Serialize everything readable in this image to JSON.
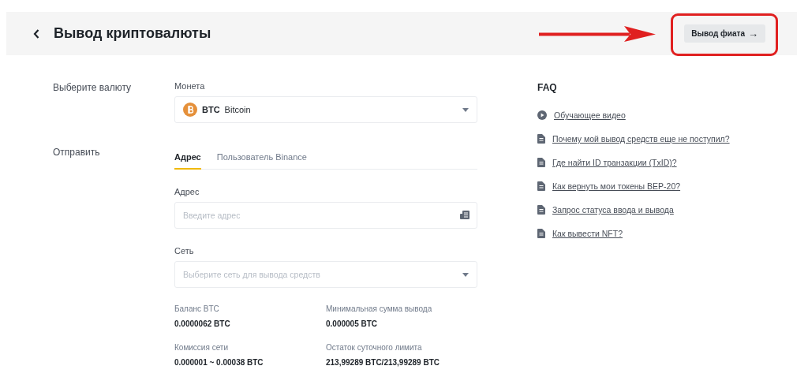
{
  "header": {
    "title": "Вывод криптовалюты",
    "button": {
      "label": "Вывод фиата",
      "icon": "→"
    }
  },
  "form": {
    "currency": {
      "section_label": "Выберите валюту",
      "field_label": "Монета",
      "coin_code": "BTC",
      "coin_name": "Bitcoin"
    },
    "send": {
      "section_label": "Отправить",
      "tabs": [
        {
          "label": "Адрес",
          "selected": true
        },
        {
          "label": "Пользователь Binance",
          "selected": false
        }
      ],
      "address": {
        "label": "Адрес",
        "placeholder": "Введите адрес"
      },
      "network": {
        "label": "Сеть",
        "placeholder": "Выберите сеть для вывода средств"
      },
      "info": [
        {
          "label": "Баланс BTC",
          "value": "0.0000062 BTC"
        },
        {
          "label": "Минимальная сумма вывода",
          "value": "0.000005 BTC"
        },
        {
          "label": "Комиссия сети",
          "value": "0.000001 ~ 0.00038 BTC"
        },
        {
          "label": "Остаток суточного лимита",
          "value": "213,99289 BTC/213,99289 BTC"
        }
      ]
    }
  },
  "faq": {
    "title": "FAQ",
    "items": [
      {
        "kind": "video",
        "text": "Обучающее видео"
      },
      {
        "kind": "article",
        "text": "Почему мой вывод средств еще не поступил?"
      },
      {
        "kind": "article",
        "text": "Где найти ID транзакции (TxID)?"
      },
      {
        "kind": "article",
        "text": "Как вернуть мои токены BEP-20?"
      },
      {
        "kind": "article",
        "text": "Запрос статуса ввода и вывода"
      },
      {
        "kind": "article",
        "text": "Как вывести NFT?"
      }
    ]
  }
}
